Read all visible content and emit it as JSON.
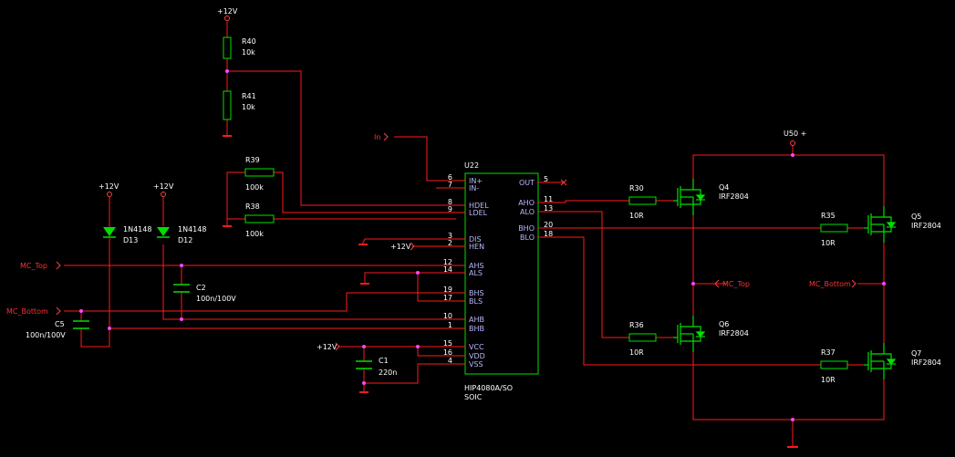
{
  "colors": {
    "background": "#000000",
    "wire": "#ff1a1a",
    "component": "#00e000",
    "component_text": "#ffffff",
    "pin_label": "#b8b8ff",
    "junction": "#ff44ff",
    "signal": "#ff3030",
    "port": "#ff4040"
  },
  "power": {
    "p12": "+12V",
    "u50": "U50 +"
  },
  "signals": {
    "in": "In",
    "mc_top": "MC_Top",
    "mc_bottom": "MC_Bottom"
  },
  "ic": {
    "ref": "U22",
    "part": "HIP4080A/SO",
    "package": "SOIC",
    "left_pins": [
      {
        "num": "6",
        "name": "IN+"
      },
      {
        "num": "7",
        "name": "IN-"
      },
      {
        "num": "8",
        "name": "HDEL"
      },
      {
        "num": "9",
        "name": "LDEL"
      },
      {
        "num": "3",
        "name": "DIS"
      },
      {
        "num": "2",
        "name": "HEN"
      },
      {
        "num": "12",
        "name": "AHS"
      },
      {
        "num": "14",
        "name": "ALS"
      },
      {
        "num": "19",
        "name": "BHS"
      },
      {
        "num": "17",
        "name": "BLS"
      },
      {
        "num": "10",
        "name": "AHB"
      },
      {
        "num": "1",
        "name": "BHB"
      },
      {
        "num": "15",
        "name": "VCC"
      },
      {
        "num": "16",
        "name": "VDD"
      },
      {
        "num": "4",
        "name": "VSS"
      }
    ],
    "right_pins": [
      {
        "num": "5",
        "name": "OUT"
      },
      {
        "num": "11",
        "name": "AHO"
      },
      {
        "num": "13",
        "name": "ALO"
      },
      {
        "num": "20",
        "name": "BHO"
      },
      {
        "num": "18",
        "name": "BLO"
      }
    ]
  },
  "resistors": {
    "r40": {
      "ref": "R40",
      "value": "10k"
    },
    "r41": {
      "ref": "R41",
      "value": "10k"
    },
    "r39": {
      "ref": "R39",
      "value": "100k"
    },
    "r38": {
      "ref": "R38",
      "value": "100k"
    },
    "r30": {
      "ref": "R30",
      "value": "10R"
    },
    "r35": {
      "ref": "R35",
      "value": "10R"
    },
    "r36": {
      "ref": "R36",
      "value": "10R"
    },
    "r37": {
      "ref": "R37",
      "value": "10R"
    }
  },
  "capacitors": {
    "c5": {
      "ref": "C5",
      "value": "100n/100V"
    },
    "c2": {
      "ref": "C2",
      "value": "100n/100V"
    },
    "c1": {
      "ref": "C1",
      "value": "220n"
    }
  },
  "diodes": {
    "d13": {
      "ref": "D13",
      "value": "1N4148"
    },
    "d12": {
      "ref": "D12",
      "value": "1N4148"
    }
  },
  "mosfets": {
    "q4": {
      "ref": "Q4",
      "value": "IRF2804"
    },
    "q5": {
      "ref": "Q5",
      "value": "IRF2804"
    },
    "q6": {
      "ref": "Q6",
      "value": "IRF2804"
    },
    "q7": {
      "ref": "Q7",
      "value": "IRF2804"
    }
  }
}
